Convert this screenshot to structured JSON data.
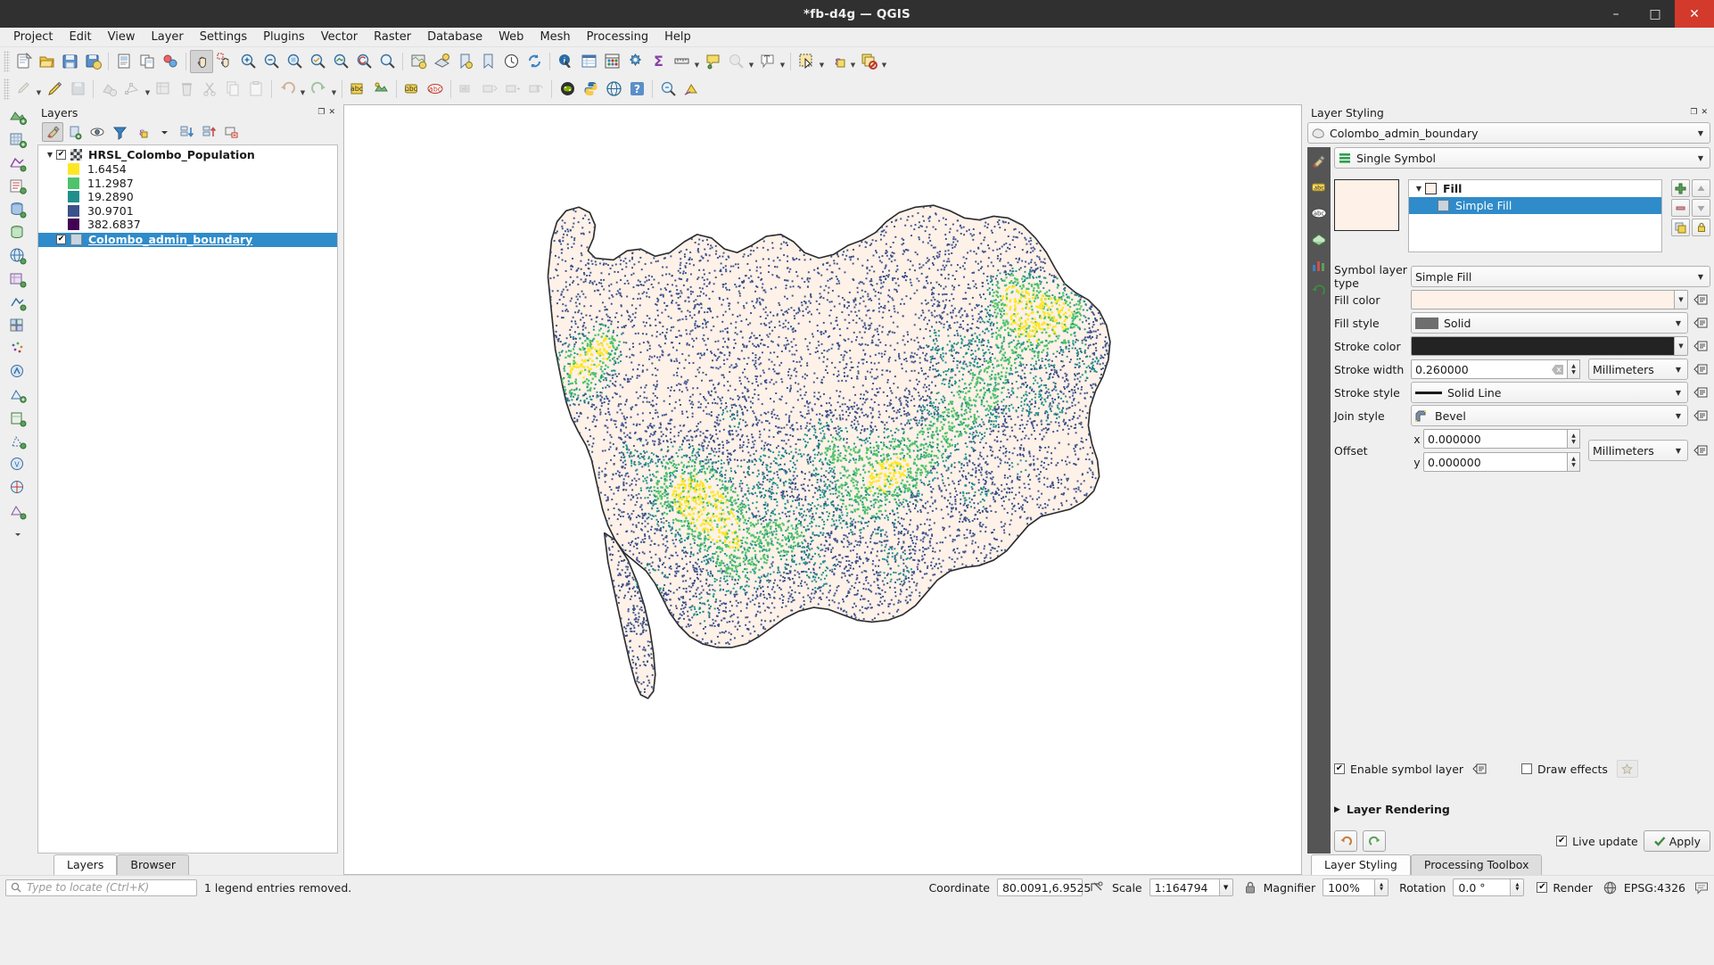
{
  "window": {
    "title": "*fb-d4g — QGIS",
    "minimize": "–",
    "maximize": "□",
    "close": "✕"
  },
  "menubar": {
    "items": [
      "Project",
      "Edit",
      "View",
      "Layer",
      "Settings",
      "Plugins",
      "Vector",
      "Raster",
      "Database",
      "Web",
      "Mesh",
      "Processing",
      "Help"
    ]
  },
  "layers_panel": {
    "title": "Layers",
    "toolbar_icons": [
      "open-layer-styling-panel-icon",
      "add-group-icon",
      "manage-map-themes-icon",
      "filter-legend-icon",
      "filter-legend-expression-icon",
      "expand-all-icon",
      "collapse-all-icon",
      "remove-layer-icon"
    ],
    "tree": [
      {
        "name": "HRSL_Colombo_Population",
        "checked": "✔",
        "expanded": true,
        "selected": false,
        "type": "raster",
        "legend": [
          {
            "value": "1.6454",
            "color": "#fde725"
          },
          {
            "value": "11.2987",
            "color": "#4ec36b"
          },
          {
            "value": "19.2890",
            "color": "#1f8f8a"
          },
          {
            "value": "30.9701",
            "color": "#3b518b"
          },
          {
            "value": "382.6837",
            "color": "#440154"
          }
        ]
      },
      {
        "name": "Colombo_admin_boundary",
        "checked": "✔",
        "expanded": false,
        "selected": true,
        "type": "vector-polygon",
        "swatch_color": "#c8d4de"
      }
    ],
    "tabs": [
      {
        "label": "Layers",
        "active": true
      },
      {
        "label": "Browser",
        "active": false
      }
    ]
  },
  "map": {
    "fill_color": "#fdf1e8",
    "stroke_color": "#262626",
    "background": "#ffffff"
  },
  "style_panel": {
    "title": "Layer Styling",
    "dock_buttons": [
      "float-panel-icon",
      "close-panel-icon"
    ],
    "layer_combo": "Colombo_admin_boundary",
    "renderer_combo": "Single Symbol",
    "side_tabs": [
      "symbology-icon",
      "labels-icon",
      "masks-icon",
      "3d-view-icon",
      "diagrams-icon",
      "history-icon"
    ],
    "symbol_tree": [
      {
        "label": "Fill",
        "selected": false,
        "bold": true
      },
      {
        "label": "Simple Fill",
        "selected": true,
        "bold": false
      }
    ],
    "symbol_buttons": [
      "add-symbol-layer-icon",
      "move-up-icon",
      "remove-symbol-layer-icon",
      "move-down-icon",
      "duplicate-icon",
      "lock-icon"
    ],
    "properties": {
      "symbol_layer_type_label": "Symbol layer type",
      "symbol_layer_type_value": "Simple Fill",
      "fill_color_label": "Fill color",
      "fill_color_value": "#fdf1e8",
      "fill_style_label": "Fill style",
      "fill_style_value": "Solid",
      "stroke_color_label": "Stroke color",
      "stroke_color_value": "#232323",
      "stroke_width_label": "Stroke width",
      "stroke_width_value": "0.260000",
      "stroke_width_unit": "Millimeters",
      "stroke_style_label": "Stroke style",
      "stroke_style_value": "Solid Line",
      "join_style_label": "Join style",
      "join_style_value": "Bevel",
      "offset_label": "Offset",
      "offset_x_axis": "x",
      "offset_x_value": "0.000000",
      "offset_y_axis": "y",
      "offset_y_value": "0.000000",
      "offset_unit": "Millimeters"
    },
    "footer": {
      "enable_symbol_layer_label": "Enable symbol layer",
      "enable_symbol_layer_checked": "✔",
      "draw_effects_label": "Draw effects",
      "draw_effects_checked": "",
      "layer_rendering_label": "Layer Rendering",
      "live_update_label": "Live update",
      "live_update_checked": "✔",
      "apply_label": "Apply"
    },
    "tabs": [
      {
        "label": "Layer Styling",
        "active": true
      },
      {
        "label": "Processing Toolbox",
        "active": false
      }
    ]
  },
  "statusbar": {
    "locator_placeholder": "Type to locate (Ctrl+K)",
    "message": "1 legend entries removed.",
    "coordinate_label": "Coordinate",
    "coordinate_value": "80.0091,6.9525",
    "scale_label": "Scale",
    "scale_value": "1:164794",
    "magnifier_label": "Magnifier",
    "magnifier_value": "100%",
    "rotation_label": "Rotation",
    "rotation_value": "0.0 °",
    "render_label": "Render",
    "render_checked": "✔",
    "crs_label": "EPSG:4326"
  }
}
